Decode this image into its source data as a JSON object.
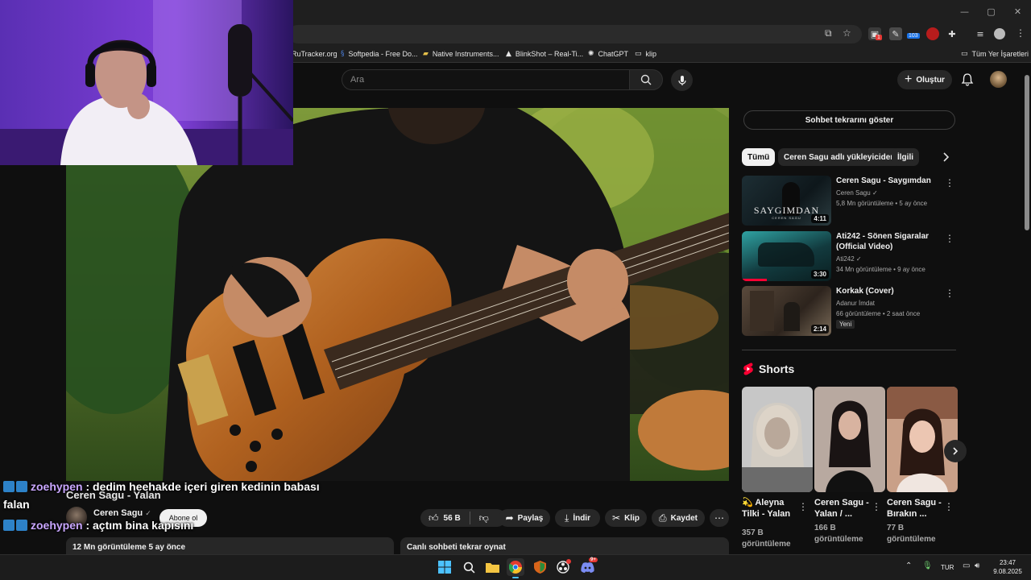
{
  "browser": {
    "window_controls": [
      "—",
      "▢",
      "✕"
    ],
    "badge_red": "1",
    "badge_blue": "103",
    "bookmarks": [
      {
        "label": "RuTracker.org",
        "icon": "web-icon"
      },
      {
        "label": "Softpedia - Free Do...",
        "icon": "softpedia-icon"
      },
      {
        "label": "Native Instruments...",
        "icon": "folder-icon"
      },
      {
        "label": "BlinkShot – Real-Ti...",
        "icon": "triangle-icon"
      },
      {
        "label": "ChatGPT",
        "icon": "chatgpt-icon"
      },
      {
        "label": "klip",
        "icon": "folder-icon"
      }
    ],
    "all_bookmarks": "Tüm Yer İşaretleri"
  },
  "header": {
    "search_placeholder": "Ara",
    "create_label": "Oluştur"
  },
  "video": {
    "title": "Ceren Sagu - Yalan",
    "channel": "Ceren Sagu",
    "subscribe_label": "Abone ol",
    "likes": "56 B",
    "share_label": "Paylaş",
    "download_label": "İndir",
    "clip_label": "Klip",
    "save_label": "Kaydet",
    "views_date": "12 Mn görüntüleme  5 ay önce",
    "chat_replay_label": "Canlı sohbeti tekrar oynat"
  },
  "chat_overlay": [
    {
      "user": "zoehypen",
      "message": ": dedim heehakde içeri giren kedinin babası",
      "cont": "falan"
    },
    {
      "user": "zoehypen",
      "message": ": açtım bina kapısını"
    }
  ],
  "sidebar": {
    "show_chat_replay": "Sohbet tekrarını göster",
    "chips": [
      "Tümü",
      "Ceren Sagu adlı yükleyiciden",
      "İlgili"
    ],
    "recommendations": [
      {
        "title": "Ceren Sagu - Saygımdan",
        "channel": "Ceren Sagu",
        "meta": "5,8 Mn görüntüleme • 5 ay önce",
        "duration": "4:11",
        "thumb_text": "SAYGIMDAN",
        "thumb_sub": "CEREN SAGU"
      },
      {
        "title": "Ati242 - Sönen Sigaralar (Official Video)",
        "channel": "Ati242",
        "meta": "34 Mn görüntüleme • 9 ay önce",
        "duration": "3:30",
        "watched": 0.28
      },
      {
        "title": "Korkak (Cover)",
        "channel": "Adanur İmdat",
        "meta": "66 görüntüleme • 2 saat önce",
        "duration": "2:14",
        "badge": "Yeni"
      }
    ],
    "shorts_title": "Shorts",
    "shorts": [
      {
        "title": "💫 Aleyna Tilki - Yalan",
        "views": "357 B görüntüleme"
      },
      {
        "title": "Ceren Sagu - Yalan / ...",
        "views": "166 B görüntüleme"
      },
      {
        "title": "Ceren Sagu - Bırakın ...",
        "views": "77 B görüntüleme"
      }
    ]
  },
  "taskbar": {
    "lang": "TUR",
    "time": "23:47",
    "date": "9.08.2025",
    "discord_badge": "9+"
  },
  "colors": {
    "accent_red": "#ff0033",
    "background": "#0f0f0f",
    "chat_user": "#c9a6ff"
  }
}
